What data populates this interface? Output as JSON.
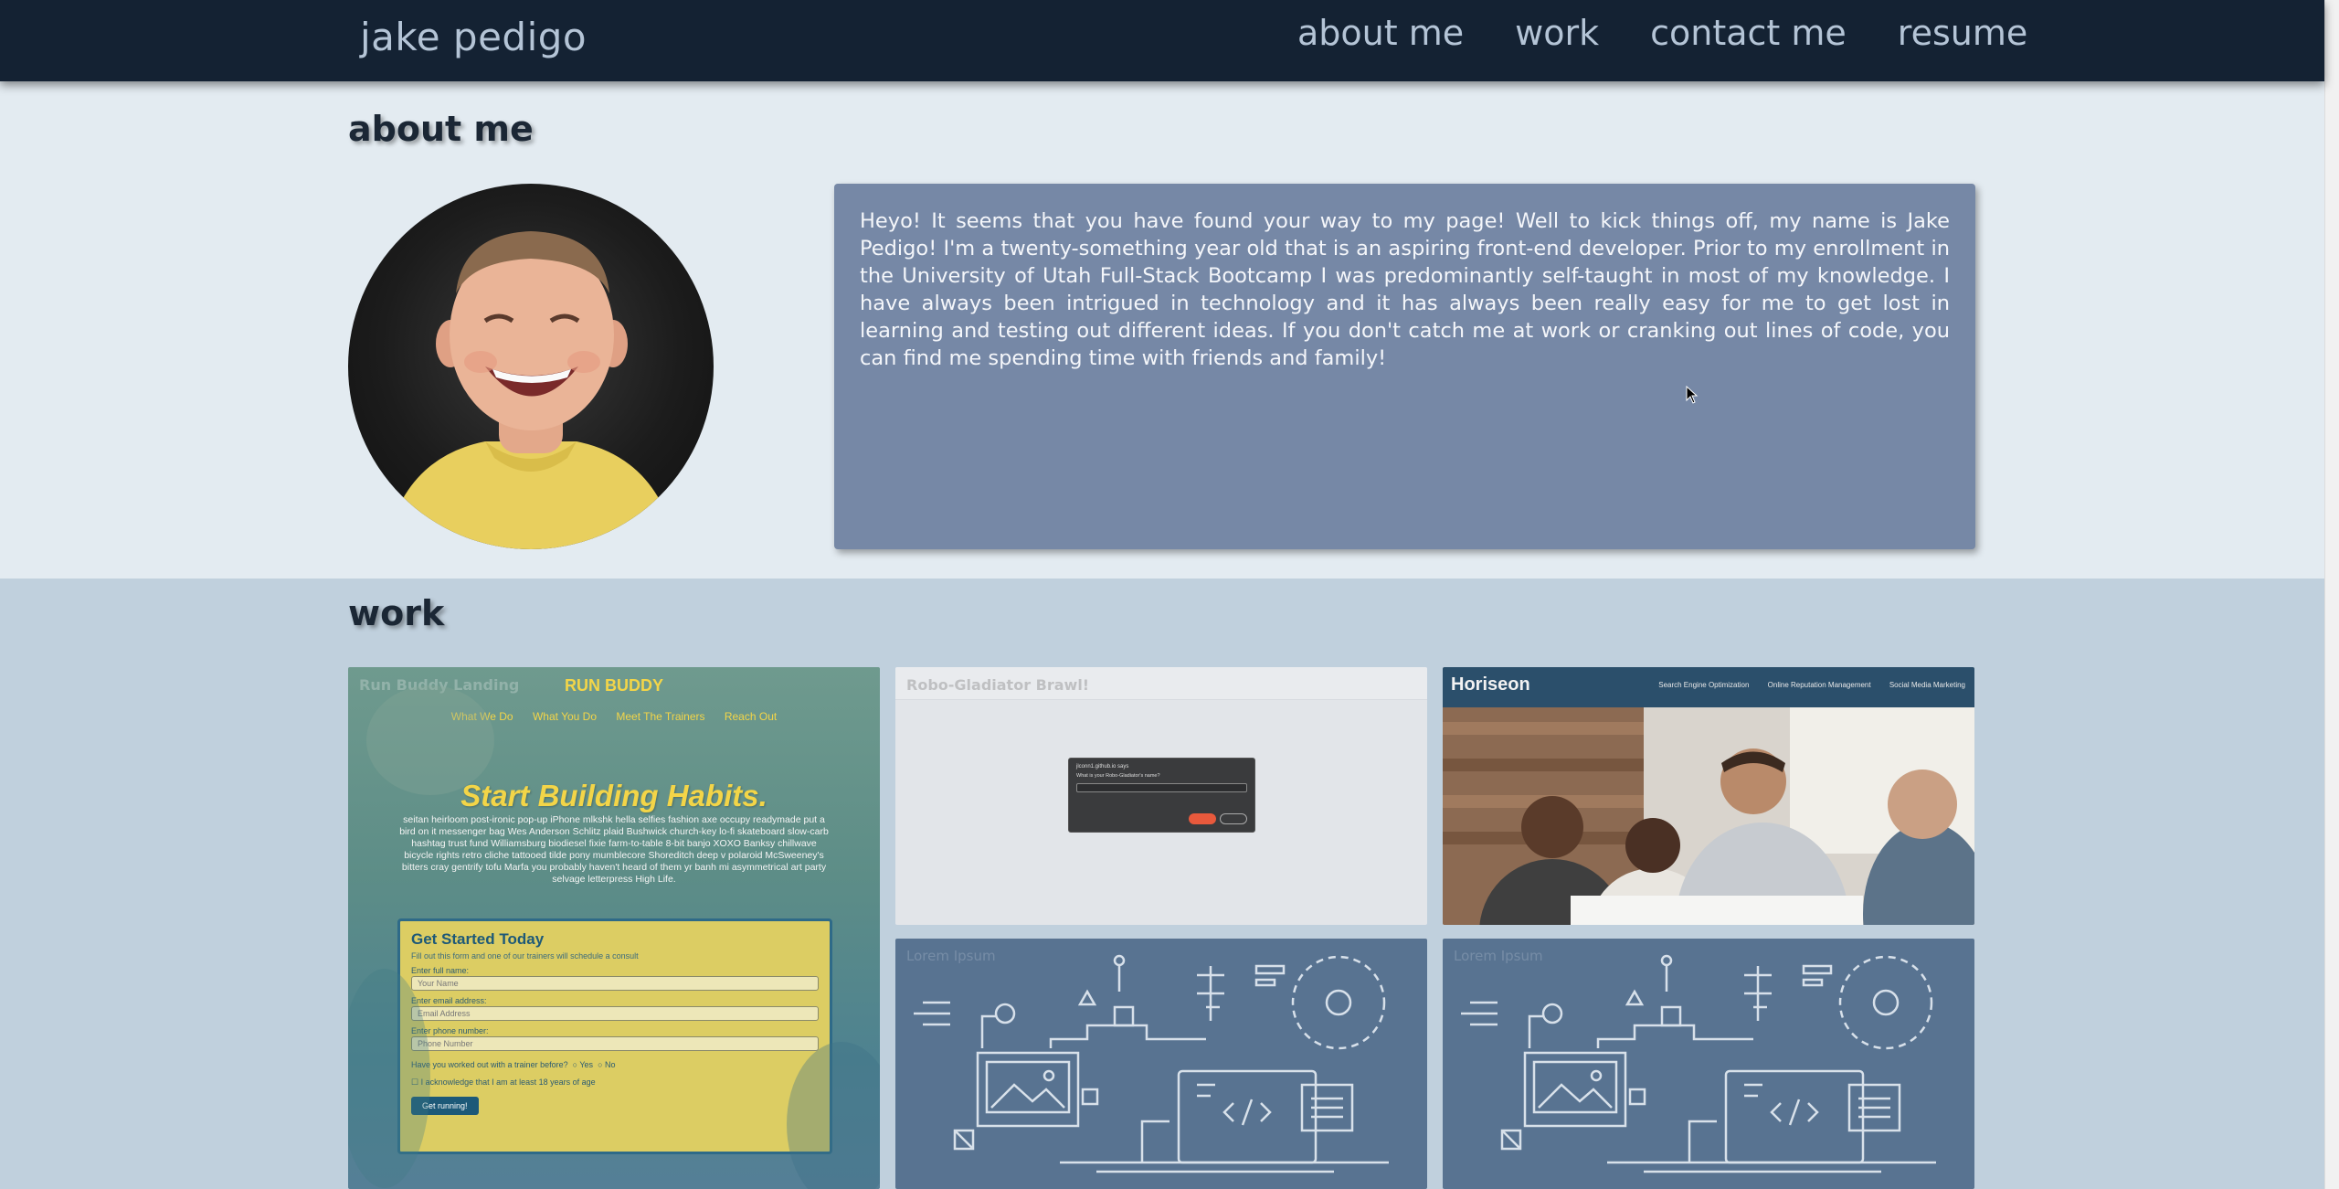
{
  "header": {
    "brand": "jake pedigo",
    "nav": [
      "about me",
      "work",
      "contact me",
      "resume"
    ]
  },
  "about": {
    "title": "about me",
    "bio": "Heyo! It seems that you have found your way to my page! Well to kick things off, my name is Jake Pedigo! I'm a twenty-something year old that is an aspiring front-end developer. Prior to my enrollment in the University of Utah Full-Stack Bootcamp I was predominantly self-taught in most of my knowledge. I have always been intrigued in technology and it has always been really easy for me to get lost in learning and testing out different ideas. If you don't catch me at work or cranking out lines of code, you can find me spending time with friends and family!"
  },
  "work": {
    "title": "work",
    "run_buddy": {
      "label": "Run Buddy Landing",
      "brand": "RUN BUDDY",
      "nav": [
        "What We Do",
        "What You Do",
        "Meet The Trainers",
        "Reach Out"
      ],
      "headline": "Start Building Habits.",
      "copy": "seitan heirloom post-ironic pop-up iPhone mlkshk hella selfies fashion axe occupy readymade put a bird on it messenger bag Wes Anderson Schlitz plaid Bushwick church-key lo-fi skateboard slow-carb hashtag trust fund Williamsburg biodiesel fixie farm-to-table 8-bit banjo XOXO Banksy chillwave bicycle rights retro cliche tattooed tilde pony mumblecore Shoreditch deep v polaroid McSweeney's bitters cray gentrify tofu Marfa you probably haven't heard of them yr banh mi asymmetrical art party selvage letterpress High Life.",
      "form_title": "Get Started Today",
      "form_sub": "Fill out this form and one of our trainers will schedule a consult",
      "name_label": "Enter full name:",
      "name_placeholder": "Your Name",
      "email_label": "Enter email address:",
      "email_placeholder": "Email Address",
      "phone_label": "Enter phone number:",
      "phone_placeholder": "Phone Number",
      "question": "Have you worked out with a trainer before?",
      "yes": "Yes",
      "no": "No",
      "acknowledge": "I acknowledge that I am at least 18 years of age",
      "button": "Get running!"
    },
    "robo": {
      "label": "Robo-Gladiator Brawl!",
      "dialog_line1": "jlconn1.github.io says",
      "dialog_line2": "What is your Robo-Gladiator's name?"
    },
    "horiseon": {
      "logo": "Horiseon",
      "nav": [
        "Search Engine Optimization",
        "Online Reputation Management",
        "Social Media Marketing"
      ]
    },
    "lorem1": {
      "label": "Lorem Ipsum"
    },
    "lorem2": {
      "label": "Lorem Ipsum"
    }
  },
  "colors": {
    "header_bg": "#142233",
    "about_bg": "#e3ebf1",
    "bio_box": "#7688a6",
    "work_bg": "#c0d0dd",
    "runbuddy_yellow": "#f3d548",
    "placeholder_blue": "#587391"
  }
}
